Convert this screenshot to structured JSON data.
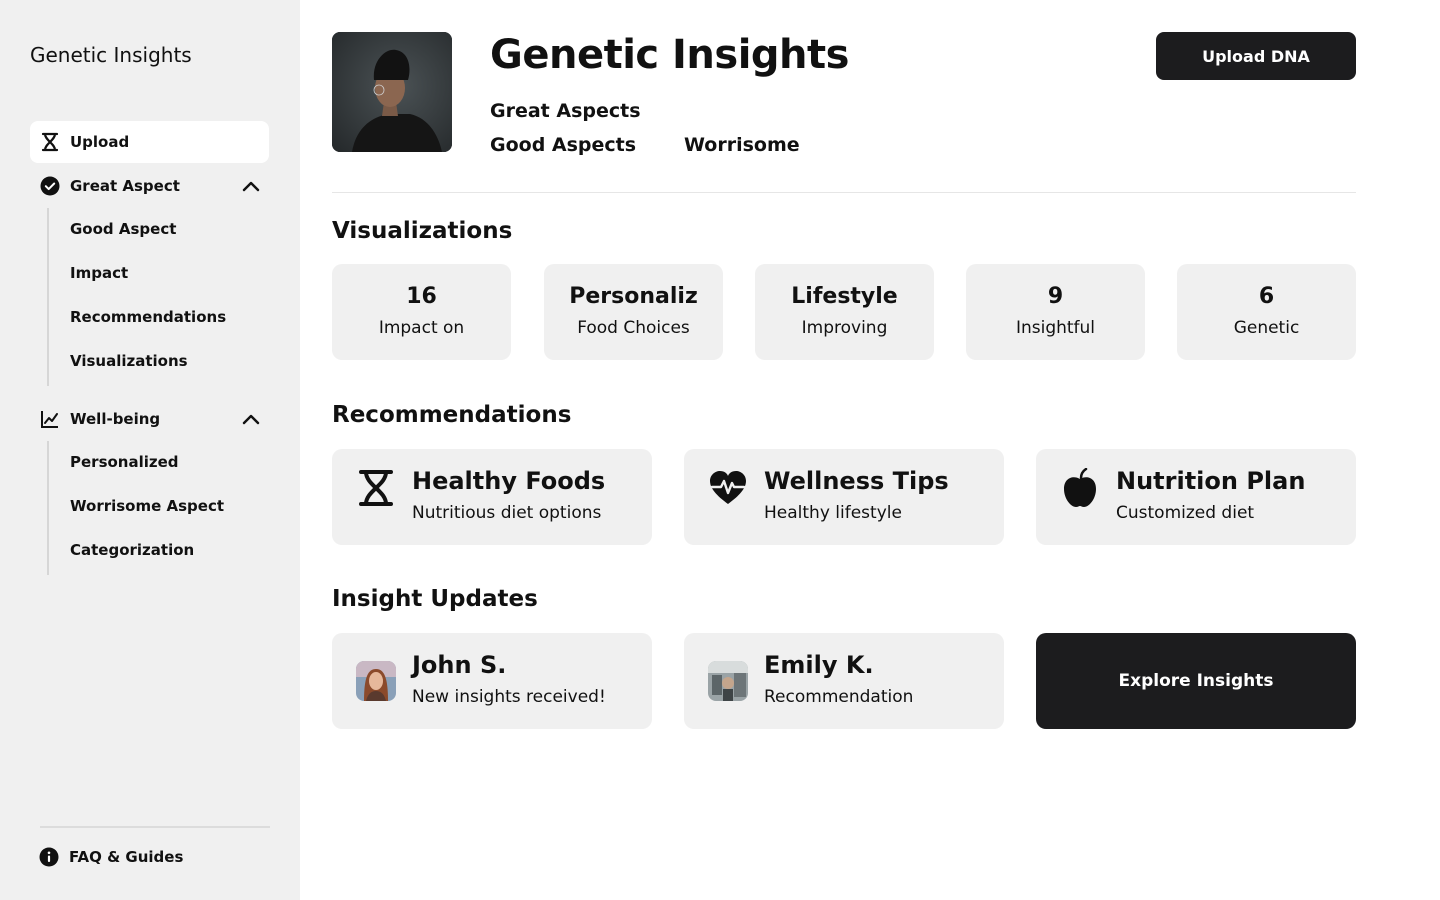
{
  "sidebar": {
    "brand": "Genetic Insights",
    "items": [
      {
        "label": "Upload",
        "icon": "dna-icon",
        "active": true
      },
      {
        "label": "Great Aspect",
        "icon": "check-circle-icon",
        "expanded": true,
        "children": [
          "Good Aspect",
          "Impact",
          "Recommendations",
          "Visualizations"
        ]
      },
      {
        "label": "Well-being",
        "icon": "chart-line-icon",
        "expanded": true,
        "children": [
          "Personalized",
          "Worrisome Aspect",
          "Categorization"
        ]
      }
    ],
    "footer": {
      "label": "FAQ & Guides",
      "icon": "info-icon"
    }
  },
  "header": {
    "title": "Genetic Insights",
    "aspects": [
      "Great Aspects",
      "Good Aspects",
      "Worrisome"
    ],
    "upload_label": "Upload DNA"
  },
  "visualizations": {
    "title": "Visualizations",
    "stats": [
      {
        "value": "16",
        "label": "Impact on"
      },
      {
        "value": "Personaliz",
        "label": "Food Choices"
      },
      {
        "value": "Lifestyle",
        "label": "Improving"
      },
      {
        "value": "9",
        "label": "Insightful"
      },
      {
        "value": "6",
        "label": "Genetic"
      }
    ]
  },
  "recommendations": {
    "title": "Recommendations",
    "cards": [
      {
        "title": "Healthy Foods",
        "subtitle": "Nutritious diet options",
        "icon": "dna-icon"
      },
      {
        "title": "Wellness Tips",
        "subtitle": "Healthy lifestyle",
        "icon": "heartbeat-icon"
      },
      {
        "title": "Nutrition Plan",
        "subtitle": "Customized diet",
        "icon": "apple-icon"
      }
    ]
  },
  "updates": {
    "title": "Insight Updates",
    "cards": [
      {
        "name": "John S.",
        "message": "New insights received!"
      },
      {
        "name": "Emily K.",
        "message": "Recommendation"
      }
    ],
    "explore_label": "Explore Insights"
  },
  "colors": {
    "sidebar_bg": "#f0f0f0",
    "card_bg": "#f0f0f0",
    "button_dark": "#1c1c1e",
    "text": "#111111"
  }
}
